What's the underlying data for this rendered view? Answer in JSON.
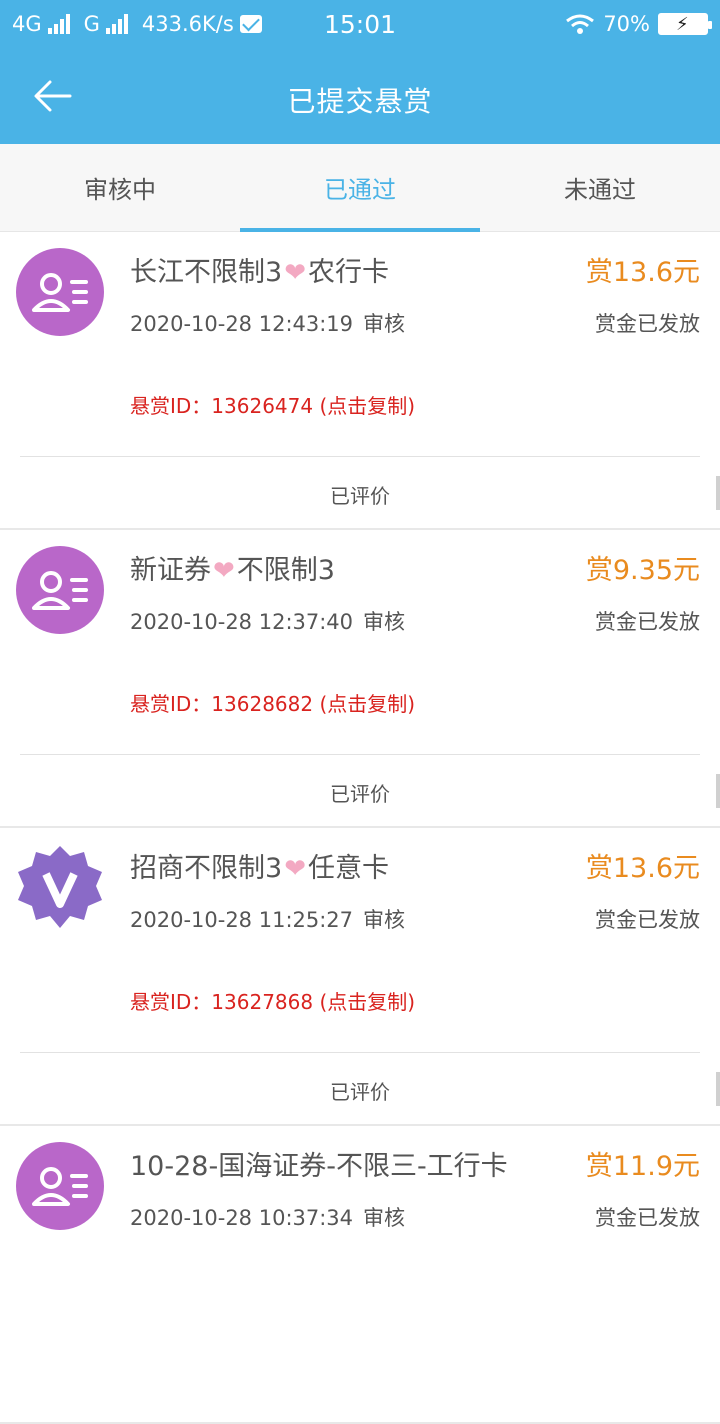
{
  "status_bar": {
    "network1": "4G",
    "network2": "G",
    "speed": "433.6K/s",
    "time": "15:01",
    "battery": "70%"
  },
  "header": {
    "title": "已提交悬赏",
    "back_icon": "arrow-left-icon"
  },
  "tabs": [
    {
      "label": "审核中",
      "active": false
    },
    {
      "label": "已通过",
      "active": true
    },
    {
      "label": "未通过",
      "active": false
    }
  ],
  "colors": {
    "primary": "#4ab3e6",
    "reward": "#e98b1f",
    "id_text": "#d9231f",
    "avatar_purple": "#b967c9",
    "badge_purple": "#8a6ac7"
  },
  "items": [
    {
      "avatar": "contact-card-icon",
      "title_a": "长江不限制3",
      "title_b": "农行卡",
      "heart": "❤",
      "reward": "赏13.6元",
      "time": "2020-10-28 12:43:19",
      "time_label": "审核",
      "status": "赏金已发放",
      "id_text": "悬赏ID：13626474 (点击复制)",
      "footer": "已评价"
    },
    {
      "avatar": "contact-card-icon",
      "title_a": "新证券",
      "title_b": "不限制3",
      "heart": "❤",
      "reward": "赏9.35元",
      "time": "2020-10-28 12:37:40",
      "time_label": "审核",
      "status": "赏金已发放",
      "id_text": "悬赏ID：13628682 (点击复制)",
      "footer": "已评价"
    },
    {
      "avatar": "vip-badge-icon",
      "title_a": "招商不限制3",
      "title_b": "任意卡",
      "heart": "❤",
      "reward": "赏13.6元",
      "time": "2020-10-28 11:25:27",
      "time_label": "审核",
      "status": "赏金已发放",
      "id_text": "悬赏ID：13627868 (点击复制)",
      "footer": "已评价"
    },
    {
      "avatar": "contact-card-icon",
      "title_a": "10-28-国海证券-不限三-工行卡",
      "title_b": "",
      "heart": "",
      "reward": "赏11.9元",
      "time": "2020-10-28 10:37:34",
      "time_label": "审核",
      "status": "赏金已发放",
      "id_text": "",
      "footer": ""
    }
  ]
}
